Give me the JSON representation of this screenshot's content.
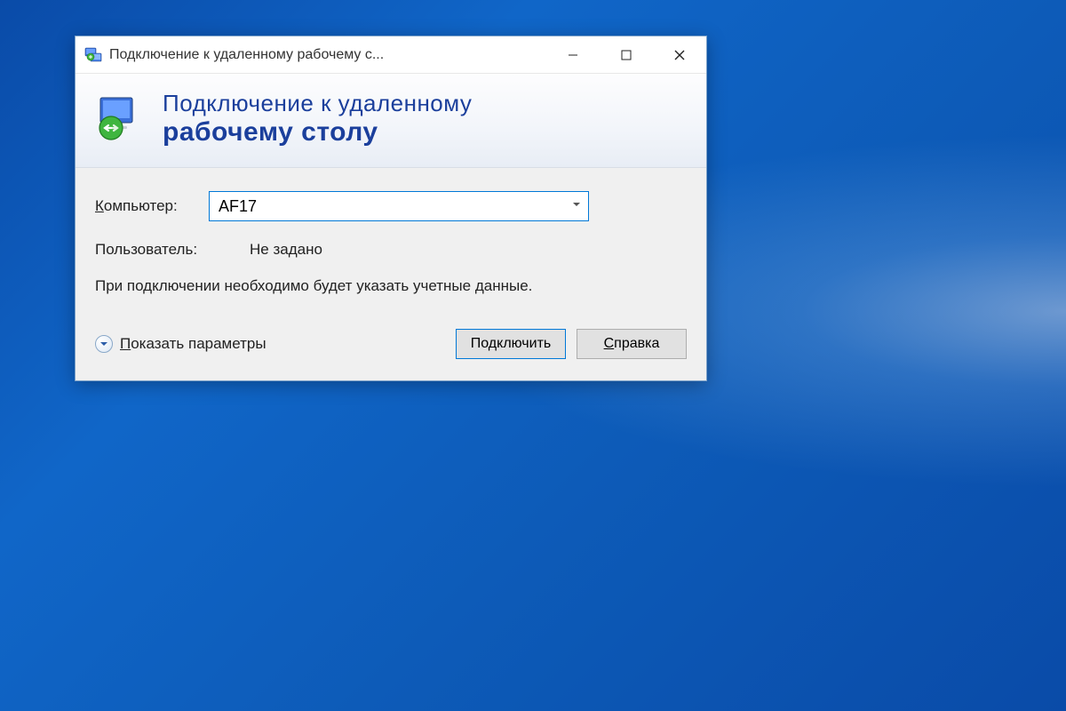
{
  "window": {
    "title": "Подключение к удаленному рабочему с..."
  },
  "header": {
    "line1": "Подключение к удаленному",
    "line2": "рабочему столу"
  },
  "form": {
    "computer_label_pre": "К",
    "computer_label_rest": "омпьютер:",
    "computer_value": "AF17",
    "user_label": "Пользователь:",
    "user_value": "Не задано",
    "info_text": "При подключении необходимо будет указать учетные данные."
  },
  "footer": {
    "show_options_pre": "П",
    "show_options_rest": "оказать параметры",
    "connect_label": "Подключить",
    "help_pre": "С",
    "help_rest": "правка"
  }
}
